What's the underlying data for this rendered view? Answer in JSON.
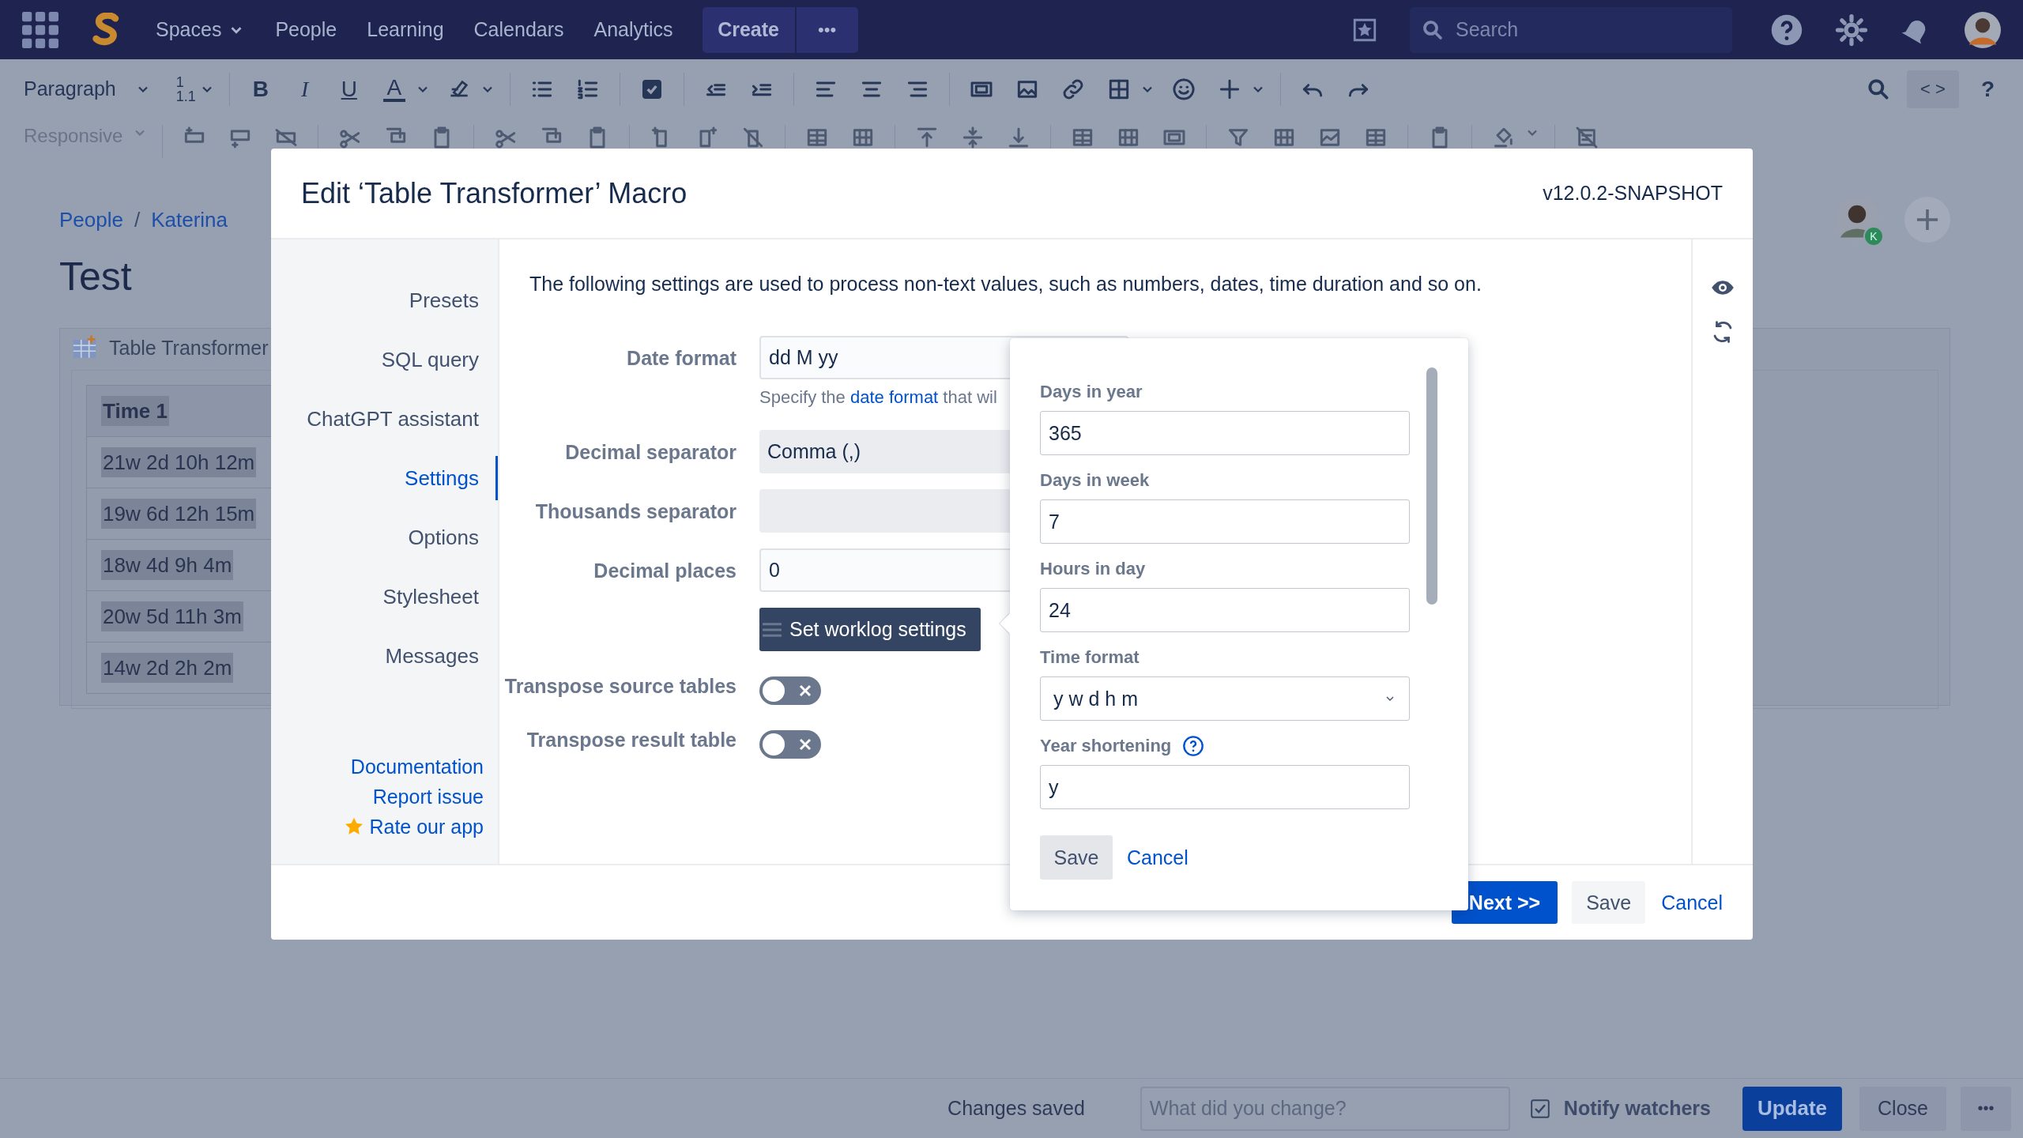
{
  "top_nav": {
    "items": [
      {
        "label": "Spaces",
        "has_menu": true
      },
      {
        "label": "People",
        "has_menu": false
      },
      {
        "label": "Learning",
        "has_menu": false
      },
      {
        "label": "Calendars",
        "has_menu": false
      },
      {
        "label": "Analytics",
        "has_menu": false
      }
    ],
    "create": "Create",
    "more": "•••",
    "search": {
      "placeholder": "Search"
    }
  },
  "editor_toolbar": {
    "paragraph": "Paragraph",
    "line_spacing": [
      "1",
      "1.1"
    ],
    "format_buttons": [
      "B",
      "I",
      "U",
      "A"
    ],
    "source_button": "< >",
    "help": "?",
    "responsive": "Responsive"
  },
  "page": {
    "breadcrumbs": [
      "People",
      "Katerina"
    ],
    "breadcrumb_separator": "/",
    "title": "Test",
    "avatar_badge": "K",
    "macro": {
      "title": "Table Transformer",
      "header": "Time 1",
      "rows": [
        "21w 2d 10h 12m",
        "19w 6d 12h 15m",
        "18w 4d 9h 4m",
        "20w 5d 11h 3m",
        "14w 2d 2h 2m"
      ]
    }
  },
  "dialog": {
    "title": "Edit ‘Table Transformer’ Macro",
    "version": "v12.0.2-SNAPSHOT",
    "nav": [
      {
        "label": "Presets",
        "selected": false
      },
      {
        "label": "SQL query",
        "selected": false
      },
      {
        "label": "ChatGPT assistant",
        "selected": false
      },
      {
        "label": "Settings",
        "selected": true
      },
      {
        "label": "Options",
        "selected": false
      },
      {
        "label": "Stylesheet",
        "selected": false
      },
      {
        "label": "Messages",
        "selected": false
      }
    ],
    "links": [
      {
        "label": "Documentation",
        "kind": "link"
      },
      {
        "label": "Report issue",
        "kind": "link"
      },
      {
        "label": "Rate our app",
        "kind": "rate"
      }
    ],
    "intro": "The following settings are used to process non-text values, such as numbers, dates, time duration and so on.",
    "fields": [
      {
        "label": "Date format",
        "kind": "input",
        "value": "dd M yy",
        "hint": {
          "before": "Specify the ",
          "link": "date format",
          "after": " that wil"
        }
      },
      {
        "label": "Decimal separator",
        "kind": "select",
        "value": "Comma (,)"
      },
      {
        "label": "Thousands separator",
        "kind": "select"
      },
      {
        "label": "Decimal places",
        "kind": "input",
        "value": "0"
      }
    ],
    "worklog_button": "Set worklog settings",
    "toggles": [
      {
        "label": "Transpose source tables",
        "on": false
      },
      {
        "label": "Transpose result table",
        "on": false
      }
    ],
    "footer": {
      "next": "Next >>",
      "save": "Save",
      "cancel": "Cancel"
    }
  },
  "worklog_popover": {
    "fields": [
      {
        "label": "Days in year",
        "kind": "input",
        "value": "365",
        "help": false
      },
      {
        "label": "Days in week",
        "kind": "input",
        "value": "7",
        "help": false
      },
      {
        "label": "Hours in day",
        "kind": "input",
        "value": "24",
        "help": false
      },
      {
        "label": "Time format",
        "kind": "select",
        "value": "y w d h m",
        "help": false
      },
      {
        "label": "Year shortening",
        "kind": "input",
        "value": "y",
        "help": true
      }
    ],
    "save": "Save",
    "cancel": "Cancel"
  },
  "bottom_bar": {
    "status": "Changes saved",
    "comment": {
      "placeholder": "What did you change?"
    },
    "notify": {
      "label": "Notify watchers",
      "checked": true
    },
    "update": "Update",
    "close": "Close",
    "more": "•••"
  }
}
